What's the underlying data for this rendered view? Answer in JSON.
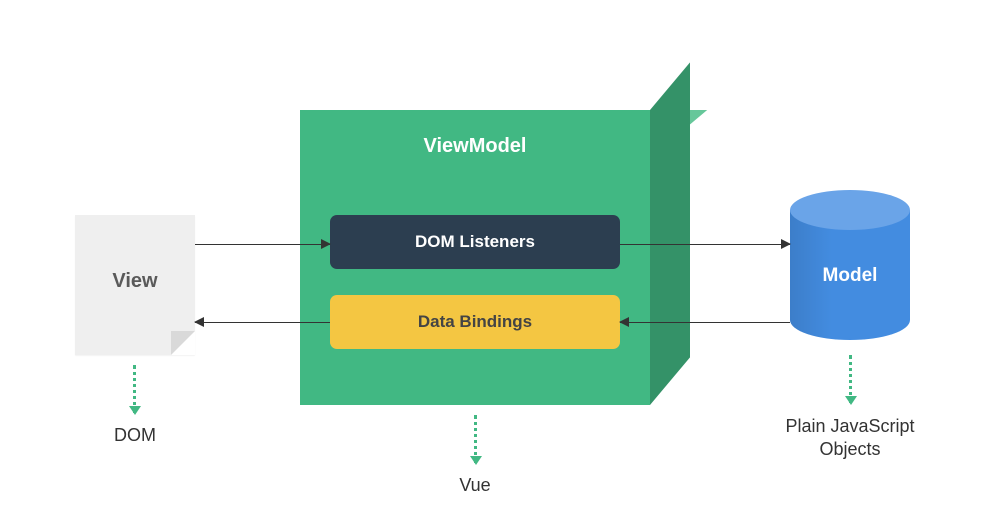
{
  "view": {
    "title": "View",
    "sublabel": "DOM"
  },
  "viewmodel": {
    "title": "ViewModel",
    "listeners_label": "DOM Listeners",
    "bindings_label": "Data Bindings",
    "sublabel": "Vue"
  },
  "model": {
    "title": "Model",
    "sublabel": "Plain JavaScript Objects"
  }
}
